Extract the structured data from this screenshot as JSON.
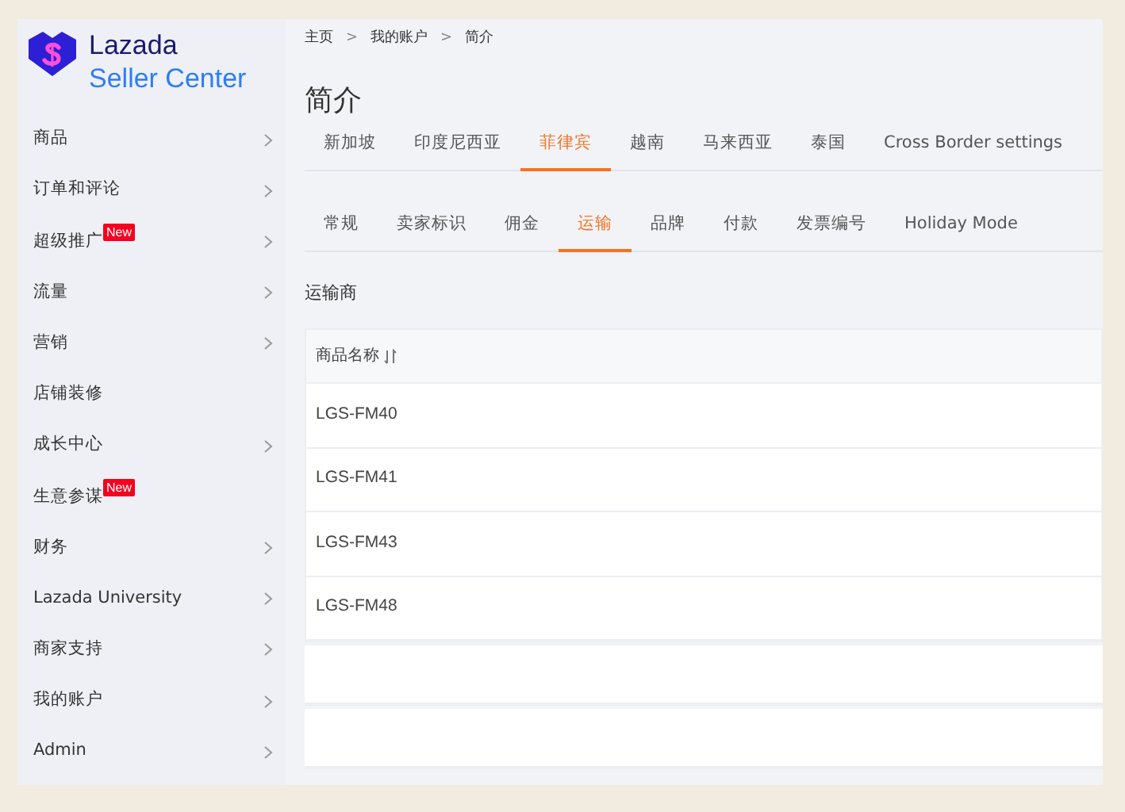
{
  "logo": {
    "brand": "Lazada",
    "product": "Seller Center"
  },
  "sidebar": {
    "items": [
      {
        "label": "商品",
        "chevron": true
      },
      {
        "label": "订单和评论",
        "chevron": true
      },
      {
        "label": "超级推广",
        "chevron": true,
        "badge": "New"
      },
      {
        "label": "流量",
        "chevron": true
      },
      {
        "label": "营销",
        "chevron": true
      },
      {
        "label": "店铺装修",
        "chevron": false
      },
      {
        "label": "成长中心",
        "chevron": true
      },
      {
        "label": "生意参谋",
        "chevron": false,
        "badge": "New"
      },
      {
        "label": "财务",
        "chevron": true
      },
      {
        "label": "Lazada University",
        "chevron": true
      },
      {
        "label": "商家支持",
        "chevron": true
      },
      {
        "label": "我的账户",
        "chevron": true
      },
      {
        "label": "Admin",
        "chevron": true
      }
    ]
  },
  "breadcrumb": [
    "主页",
    "我的账户",
    "简介"
  ],
  "breadcrumb_separator": ">",
  "page_title": "简介",
  "country_tabs": [
    {
      "label": "新加坡",
      "selected": false
    },
    {
      "label": "印度尼西亚",
      "selected": false
    },
    {
      "label": "菲律宾",
      "selected": true
    },
    {
      "label": "越南",
      "selected": false
    },
    {
      "label": "马来西亚",
      "selected": false
    },
    {
      "label": "泰国",
      "selected": false
    },
    {
      "label": "Cross Border settings",
      "selected": false
    }
  ],
  "settings_tabs": [
    {
      "label": "常规",
      "selected": false
    },
    {
      "label": "卖家标识",
      "selected": false
    },
    {
      "label": "佣金",
      "selected": false
    },
    {
      "label": "运输",
      "selected": true
    },
    {
      "label": "品牌",
      "selected": false
    },
    {
      "label": "付款",
      "selected": false
    },
    {
      "label": "发票编号",
      "selected": false
    },
    {
      "label": "Holiday Mode",
      "selected": false
    }
  ],
  "section_title": "运输商",
  "table": {
    "columns": [
      {
        "label": "商品名称",
        "sortable": true
      }
    ],
    "rows": [
      [
        "LGS-FM40"
      ],
      [
        "LGS-FM41"
      ],
      [
        "LGS-FM43"
      ],
      [
        "LGS-FM48"
      ]
    ]
  }
}
